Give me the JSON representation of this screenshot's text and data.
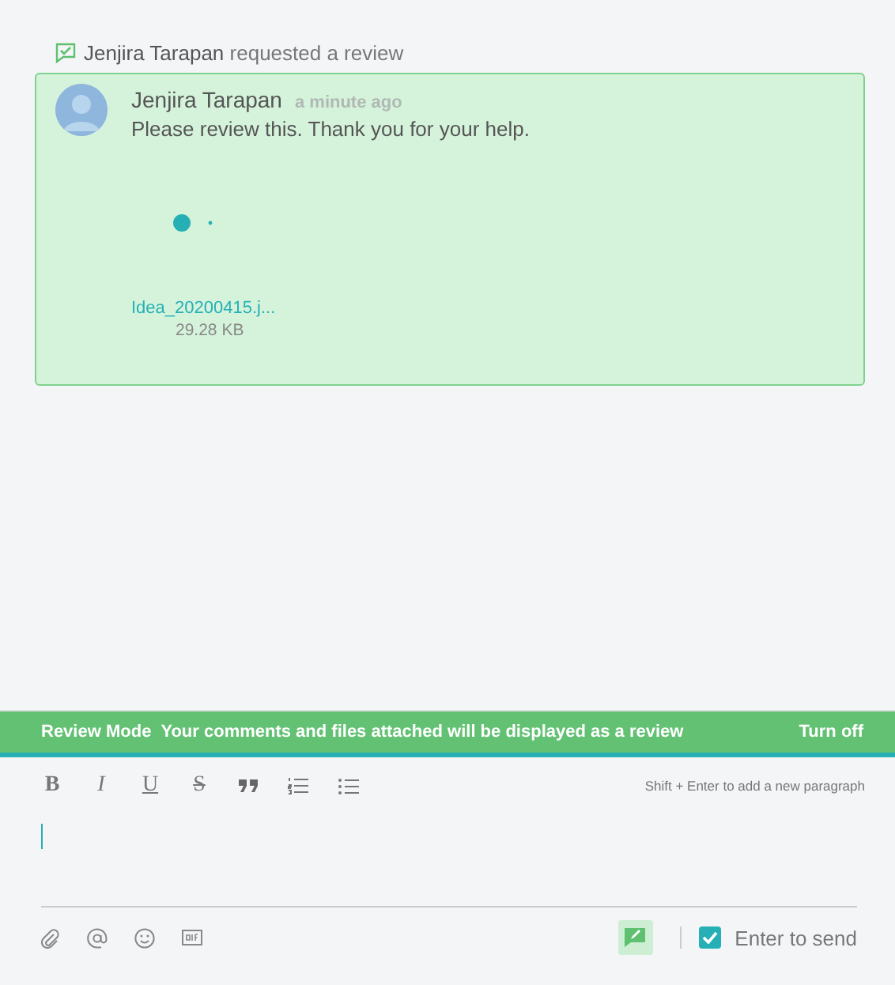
{
  "activity": {
    "actor": "Jenjira Tarapan",
    "action": "requested a review"
  },
  "review": {
    "author": "Jenjira Tarapan",
    "time": "a minute ago",
    "message": "Please review this. Thank you for your help.",
    "attachment": {
      "name": "Idea_20200415.j...",
      "size": "29.28 KB"
    }
  },
  "review_mode": {
    "on": true,
    "label": "Review Mode",
    "description": "Your comments and files attached will be displayed as a review",
    "action": "Turn off"
  },
  "toolbar": [
    {
      "kind": "bold",
      "label": "B"
    },
    {
      "kind": "italic",
      "label": "I"
    },
    {
      "kind": "underline",
      "label": "U"
    },
    {
      "kind": "strike",
      "label": "S"
    },
    {
      "kind": "quote"
    },
    {
      "kind": "ordered"
    },
    {
      "kind": "bullets"
    }
  ],
  "hint": "Shift + Enter to add a new paragraph",
  "bottom_tools": [
    {
      "kind": "attach"
    },
    {
      "kind": "mention"
    },
    {
      "kind": "emoji"
    },
    {
      "kind": "gif"
    }
  ],
  "enter_to_send": {
    "label": "Enter to send",
    "checked": true
  }
}
